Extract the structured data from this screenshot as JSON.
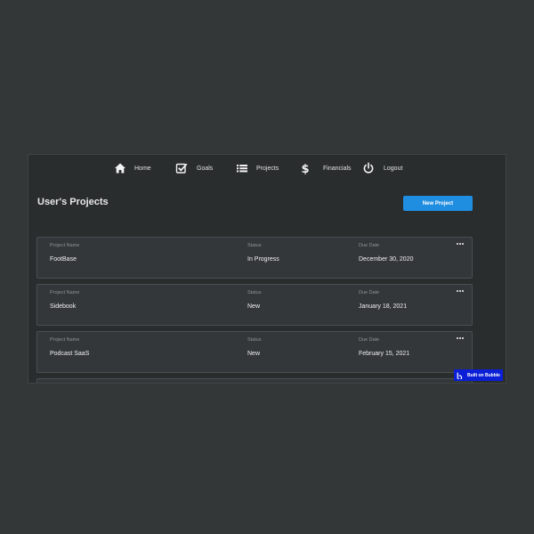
{
  "nav": {
    "items": [
      {
        "label": "Home",
        "icon": "home-icon"
      },
      {
        "label": "Goals",
        "icon": "checkbox-icon"
      },
      {
        "label": "Projects",
        "icon": "list-icon"
      },
      {
        "label": "Financials",
        "icon": "dollar-icon"
      },
      {
        "label": "Logout",
        "icon": "power-icon"
      }
    ]
  },
  "page": {
    "title": "User's Projects",
    "new_project_label": "New Project"
  },
  "columns": {
    "name": "Project Name",
    "status": "Status",
    "due": "Due Date"
  },
  "projects": [
    {
      "name": "FootBase",
      "status": "In Progress",
      "due": "December 30, 2020"
    },
    {
      "name": "Sidebook",
      "status": "New",
      "due": "January 18, 2021"
    },
    {
      "name": "Podcast SaaS",
      "status": "New",
      "due": "February 15, 2021"
    }
  ],
  "badge": {
    "label": "Built on Bubble"
  },
  "colors": {
    "background": "#343737",
    "panel": "#2a2d2e",
    "card": "#33373a",
    "accent": "#1f8de0",
    "badge": "#0a1fd6"
  }
}
